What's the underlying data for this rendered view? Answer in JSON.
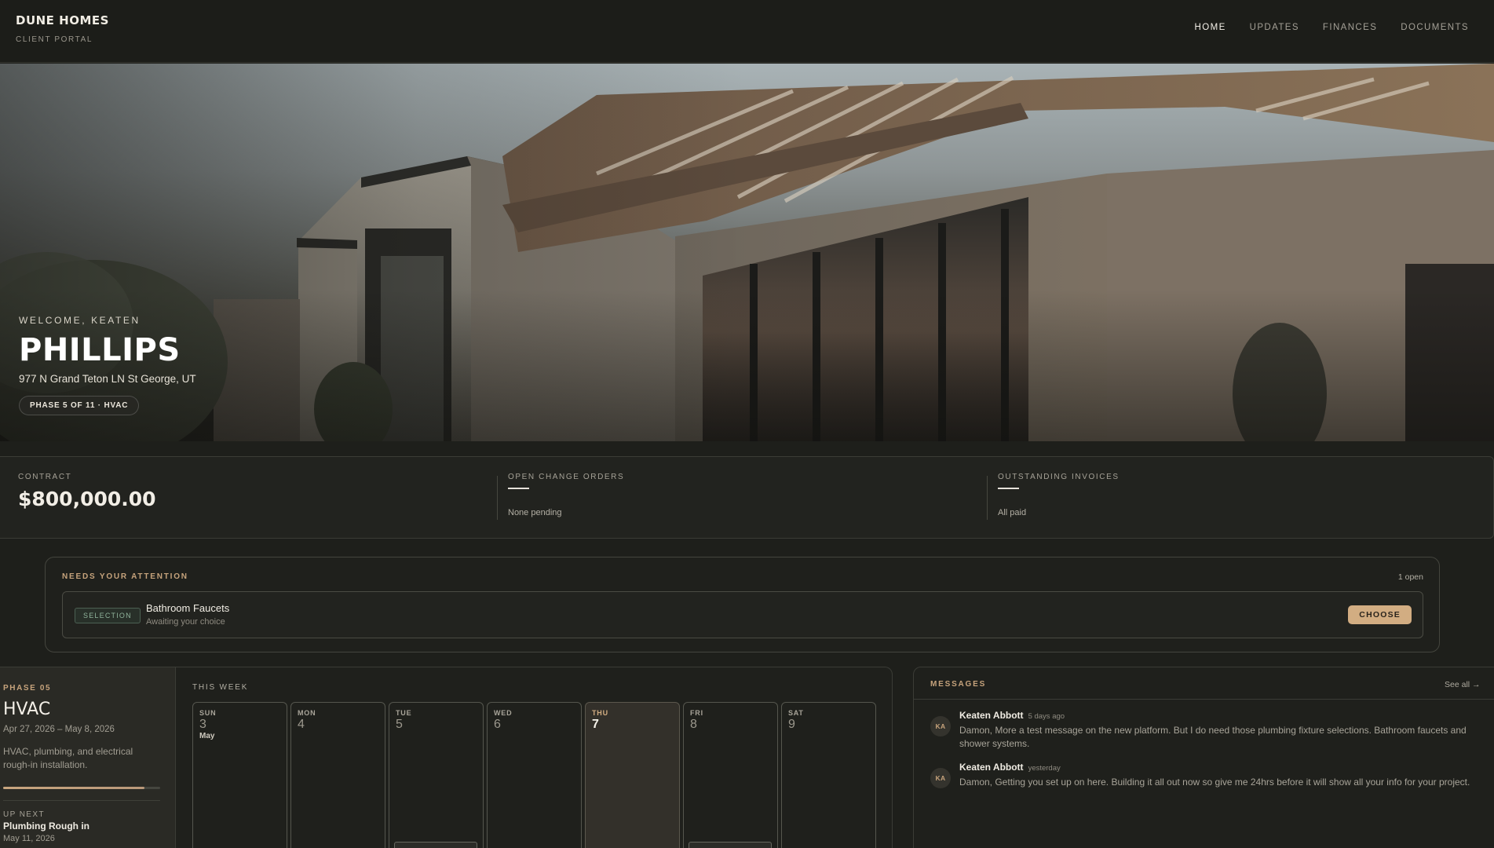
{
  "header": {
    "brand": "DUNE HOMES",
    "brand_sub": "CLIENT PORTAL",
    "nav": [
      {
        "label": "HOME",
        "active": true
      },
      {
        "label": "UPDATES",
        "active": false
      },
      {
        "label": "FINANCES",
        "active": false
      },
      {
        "label": "DOCUMENTS",
        "active": false
      }
    ]
  },
  "hero": {
    "welcome": "WELCOME, KEATEN",
    "title": "PHILLIPS",
    "address": "977 N Grand Teton LN St George, UT",
    "phase_pill": "PHASE 5 OF 11 · HVAC"
  },
  "stats": {
    "contract": {
      "label": "CONTRACT",
      "value": "$800,000.00"
    },
    "change_orders": {
      "label": "OPEN CHANGE ORDERS",
      "value": "—",
      "note": "None pending"
    },
    "invoices": {
      "label": "OUTSTANDING INVOICES",
      "value": "—",
      "note": "All paid"
    }
  },
  "attention": {
    "label": "NEEDS YOUR ATTENTION",
    "count": "1 open",
    "item": {
      "badge": "SELECTION",
      "title": "Bathroom Faucets",
      "subtitle": "Awaiting your choice",
      "action": "CHOOSE"
    }
  },
  "phase": {
    "number": "PHASE 05",
    "name": "HVAC",
    "dates": "Apr 27, 2026 – May 8, 2026",
    "description": "HVAC, plumbing, and electrical rough-in installation.",
    "progress": 0.9,
    "up_next_label": "UP NEXT",
    "up_next_title": "Plumbing Rough in",
    "up_next_date": "May 11, 2026"
  },
  "week": {
    "label": "THIS WEEK",
    "days": [
      {
        "name": "SUN",
        "num": "3",
        "month": "May",
        "today": false,
        "event": false
      },
      {
        "name": "MON",
        "num": "4",
        "month": "",
        "today": false,
        "event": false
      },
      {
        "name": "TUE",
        "num": "5",
        "month": "",
        "today": false,
        "event": true
      },
      {
        "name": "WED",
        "num": "6",
        "month": "",
        "today": false,
        "event": false
      },
      {
        "name": "THU",
        "num": "7",
        "month": "",
        "today": true,
        "event": false
      },
      {
        "name": "FRI",
        "num": "8",
        "month": "",
        "today": false,
        "event": true
      },
      {
        "name": "SAT",
        "num": "9",
        "month": "",
        "today": false,
        "event": false
      }
    ]
  },
  "messages": {
    "label": "MESSAGES",
    "see_all": "See all →",
    "items": [
      {
        "initials": "KA",
        "author": "Keaten Abbott",
        "time": "5 days ago",
        "body": "Damon, More a test message on the new platform. But I do need those plumbing fixture selections. Bathroom faucets and shower systems."
      },
      {
        "initials": "KA",
        "author": "Keaten Abbott",
        "time": "yesterday",
        "body": "Damon, Getting you set up on here. Building it all out now so give me 24hrs before it will show all your info for your project."
      }
    ]
  },
  "colors": {
    "accent": "#d2ad82",
    "gold_label": "#c6a37c",
    "selection_badge": "#8fb39b",
    "background": "#1e1f1b"
  }
}
